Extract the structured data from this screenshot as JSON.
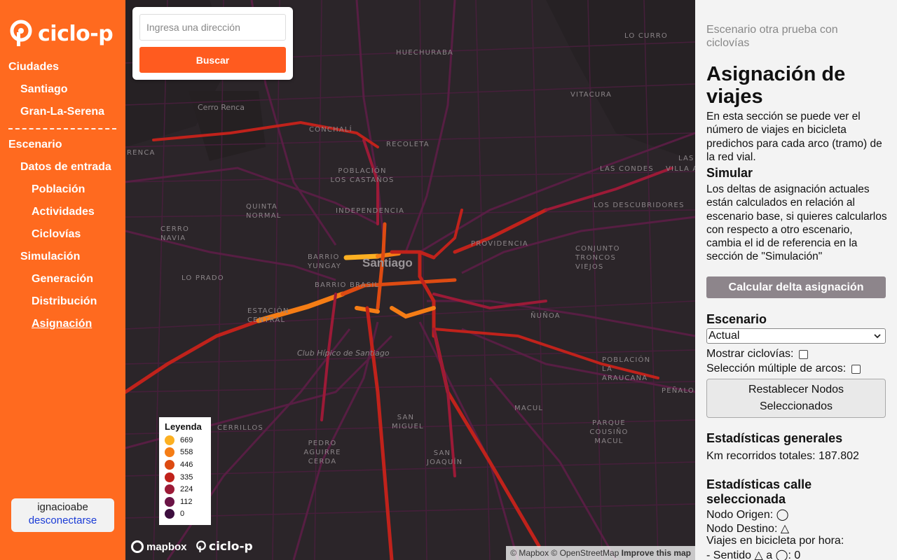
{
  "app": {
    "name": "ciclo-p"
  },
  "sidebar": {
    "cities_header": "Ciudades",
    "cities": [
      {
        "label": "Santiago"
      },
      {
        "label": "Gran-La-Serena"
      }
    ],
    "scenario_header": "Escenario",
    "inputs_header": "Datos de entrada",
    "inputs": [
      {
        "label": "Población"
      },
      {
        "label": "Actividades"
      },
      {
        "label": "Ciclovías"
      }
    ],
    "simulation_header": "Simulación",
    "simulation": [
      {
        "label": "Generación"
      },
      {
        "label": "Distribución"
      },
      {
        "label": "Asignación"
      }
    ],
    "active_item": "Asignación",
    "user": {
      "name": "ignacioabe",
      "logout": "desconectarse"
    }
  },
  "map": {
    "search": {
      "placeholder": "Ingresa una dirección",
      "button": "Buscar"
    },
    "city_label": "Santiago",
    "place_labels": [
      "LO CURRO",
      "HUECHURABA",
      "VITACURA",
      "Cerro Renca",
      "CONCHALÍ",
      "RECOLETA",
      "LAS CONDES",
      "VILLA AN",
      "POBLACIÓN LOS CASTAÑOS",
      "LOS DESCUBRIDORES",
      "INDEPENDENCIA",
      "QUINTA NORMAL",
      "CERRO NAVIA",
      "PROVIDENCIA",
      "CONJUNTO TRONCOS VIEJOS",
      "BARRIO YUNGAY",
      "BARRIO BRASIL",
      "LO PRADO",
      "ESTACIÓN CENTRAL",
      "ÑUÑOA",
      "Club Hípico de Santiago",
      "POBLACIÓN LA ARAUCANA",
      "PEÑALO",
      "MACUL",
      "CERRILLOS",
      "SAN MIGUEL",
      "PEDRO AGUIRRE CERDA",
      "PARQUE COUSIÑO MACUL",
      "SAN JOAQUÍN",
      "RENCA",
      "LAS"
    ],
    "legend": {
      "title": "Leyenda",
      "items": [
        {
          "label": "669",
          "color": "#fcb022"
        },
        {
          "label": "558",
          "color": "#f57d15"
        },
        {
          "label": "446",
          "color": "#dd4b12"
        },
        {
          "label": "335",
          "color": "#c0221b"
        },
        {
          "label": "224",
          "color": "#9c1a37"
        },
        {
          "label": "112",
          "color": "#6b1446"
        },
        {
          "label": "0",
          "color": "#3d0e3e"
        }
      ]
    },
    "mapbox_label": "mapbox",
    "brand_label": "ciclo-p",
    "attribution": {
      "text": "© Mapbox © OpenStreetMap",
      "improve": "Improve this map"
    }
  },
  "panel": {
    "scenario_name": "Escenario otra prueba con ciclovías",
    "title": "Asignación de viajes",
    "description": "En esta sección se puede ver el número de viajes en bicicleta predichos para cada arco (tramo) de la red vial.",
    "simulate_header": "Simular",
    "simulate_text": "Los deltas de asignación actuales están calculados en relación al escenario base, si quieres calcularlos con respecto a otro escenario, cambia el id de referencia en la sección de \"Simulación\"",
    "delta_button": "Calcular delta asignación",
    "scenario_header": "Escenario",
    "scenario_select": "Actual",
    "show_bikeways": "Mostrar ciclovías:",
    "multi_select": "Selección múltiple de arcos:",
    "reset_button_line1": "Restablecer Nodos",
    "reset_button_line2": "Seleccionados",
    "stats_header": "Estadísticas generales",
    "km_total": "Km recorridos totales: 187.802",
    "street_stats_header": "Estadísticas calle seleccionada",
    "origin_node": "Nodo Origen: ◯",
    "dest_node": "Nodo Destino: △",
    "trips_per_hour": "Viajes en bicicleta por hora:",
    "direction": "- Sentido △ a ◯: 0"
  }
}
